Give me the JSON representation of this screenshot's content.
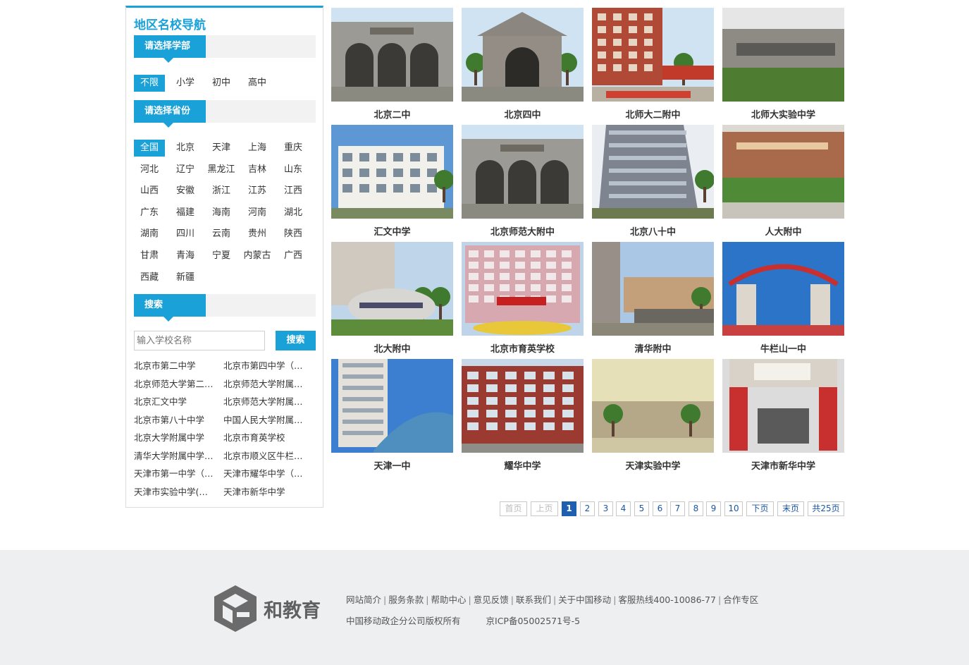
{
  "sidebar": {
    "title": "地区名校导航",
    "stage_label": "请选择学部",
    "stage_options": [
      "不限",
      "小学",
      "初中",
      "高中"
    ],
    "province_label": "请选择省份",
    "provinces": [
      "全国",
      "北京",
      "天津",
      "上海",
      "重庆",
      "河北",
      "辽宁",
      "黑龙江",
      "吉林",
      "山东",
      "山西",
      "安徽",
      "浙江",
      "江苏",
      "江西",
      "广东",
      "福建",
      "海南",
      "河南",
      "湖北",
      "湖南",
      "四川",
      "云南",
      "贵州",
      "陕西",
      "甘肃",
      "青海",
      "宁夏",
      "内蒙古",
      "广西",
      "西藏",
      "新疆"
    ],
    "search_label": "搜索",
    "search_placeholder": "输入学校名称",
    "search_button": "搜索",
    "school_links": [
      "北京市第二中学",
      "北京市第四中学（…",
      "北京师范大学第二…",
      "北京师范大学附属…",
      "北京汇文中学",
      "北京师范大学附属…",
      "北京市第八十中学",
      "中国人民大学附属…",
      "北京大学附属中学",
      "北京市育英学校",
      "清华大学附属中学…",
      "北京市顺义区牛栏…",
      "天津市第一中学（…",
      "天津市耀华中学（…",
      "天津市实验中学(…",
      "天津市新华中学"
    ]
  },
  "schools": [
    {
      "name": "北京二中",
      "img": "gate-arches"
    },
    {
      "name": "北京四中",
      "img": "gate-triangle"
    },
    {
      "name": "北师大二附中",
      "img": "red-building"
    },
    {
      "name": "北师大实验中学",
      "img": "stone-wall"
    },
    {
      "name": "汇文中学",
      "img": "white-building"
    },
    {
      "name": "北京师范大附中",
      "img": "gate-arches"
    },
    {
      "name": "北京八十中",
      "img": "tall-building"
    },
    {
      "name": "人大附中",
      "img": "brick-sign"
    },
    {
      "name": "北大附中",
      "img": "stone-rock"
    },
    {
      "name": "北京市育英学校",
      "img": "pink-building"
    },
    {
      "name": "清华附中",
      "img": "stone-sign"
    },
    {
      "name": "牛栏山一中",
      "img": "arch-gate"
    },
    {
      "name": "天津一中",
      "img": "tower"
    },
    {
      "name": "耀华中学",
      "img": "red-brick"
    },
    {
      "name": "天津实验中学",
      "img": "faded"
    },
    {
      "name": "天津市新华中学",
      "img": "gate-red"
    }
  ],
  "pager": {
    "first": "首页",
    "prev": "上页",
    "pages": [
      "1",
      "2",
      "3",
      "4",
      "5",
      "6",
      "7",
      "8",
      "9",
      "10"
    ],
    "current": "1",
    "next": "下页",
    "last": "末页",
    "total": "共25页"
  },
  "footer": {
    "logo_text": "和教育",
    "links": [
      "网站简介",
      "服务条款",
      "帮助中心",
      "意见反馈",
      "联系我们",
      "关于中国移动",
      "客服热线400-10086-77",
      "合作专区"
    ],
    "copyright": "中国移动政企分公司版权所有",
    "icp": "京ICP备05002571号-5"
  },
  "colors": {
    "accent": "#1aa1d8",
    "pager_current": "#1f5fb0",
    "footer_bg": "#eeeff1"
  }
}
